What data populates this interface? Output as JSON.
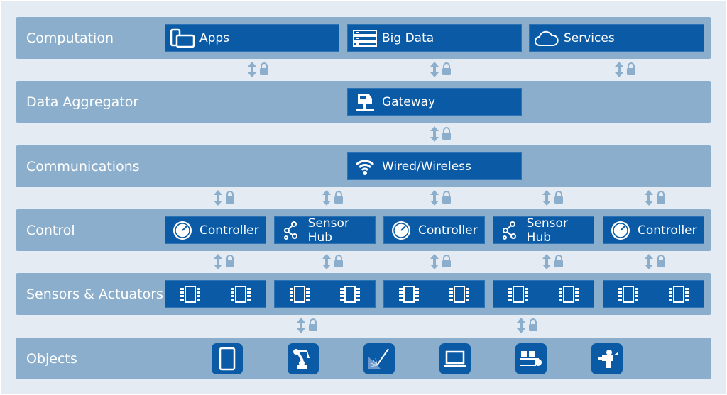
{
  "colors": {
    "background": "#e4ebf3",
    "band": "#8aaecb",
    "box": "#0b5aa5",
    "arrow": "#8aaecb"
  },
  "layers": [
    {
      "label": "Computation",
      "boxes": [
        {
          "label": "Apps",
          "icon": "mobile-devices-icon"
        },
        {
          "label": "Big Data",
          "icon": "server-rack-icon"
        },
        {
          "label": "Services",
          "icon": "cloud-icon"
        }
      ]
    },
    {
      "label": "Data Aggregator",
      "boxes": [
        {
          "label": "Gateway",
          "icon": "gateway-icon"
        }
      ]
    },
    {
      "label": "Communications",
      "boxes": [
        {
          "label": "Wired/Wireless",
          "icon": "wifi-icon"
        }
      ]
    },
    {
      "label": "Control",
      "boxes": [
        {
          "label": "Controller",
          "icon": "gauge-icon"
        },
        {
          "label": "Sensor Hub",
          "icon": "sensor-hub-icon"
        },
        {
          "label": "Controller",
          "icon": "gauge-icon"
        },
        {
          "label": "Sensor Hub",
          "icon": "sensor-hub-icon"
        },
        {
          "label": "Controller",
          "icon": "gauge-icon"
        }
      ]
    },
    {
      "label": "Sensors & Actuators",
      "boxes": [
        {
          "icon": "chip-icon"
        },
        {
          "icon": "chip-icon"
        },
        {
          "icon": "chip-icon"
        },
        {
          "icon": "chip-icon"
        },
        {
          "icon": "chip-icon"
        }
      ]
    },
    {
      "label": "Objects",
      "objects": [
        "tablet-icon",
        "robot-arm-icon",
        "laser-icon",
        "laptop-icon",
        "conveyor-icon",
        "robot-icon"
      ]
    }
  ],
  "connector_icons": [
    "bidirectional-arrow-icon",
    "lock-icon"
  ]
}
